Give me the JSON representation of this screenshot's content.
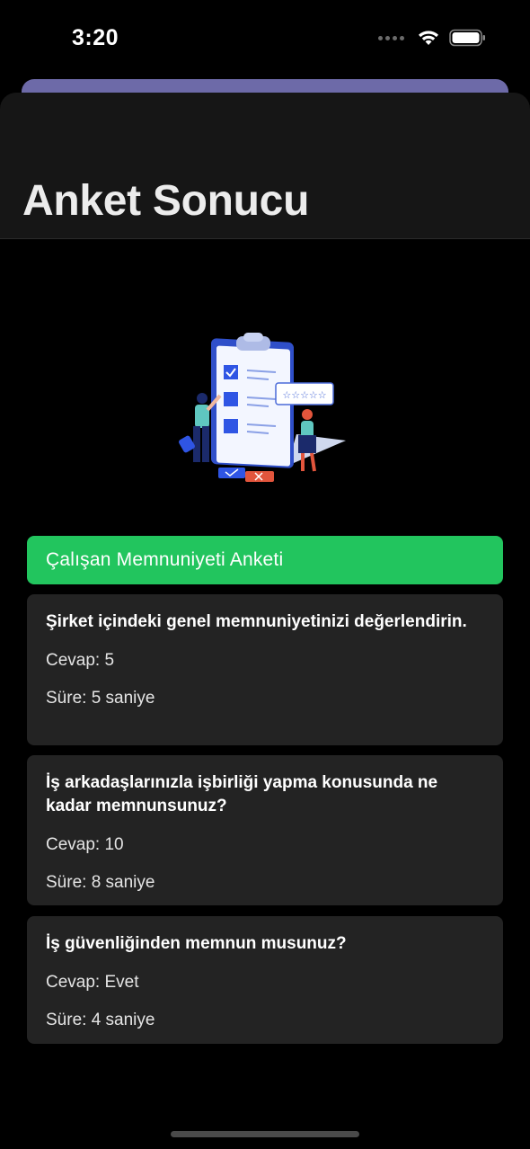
{
  "status_bar": {
    "time": "3:20"
  },
  "header": {
    "title": "Anket Sonucu"
  },
  "illustration": {
    "name": "survey-clipboard-illustration"
  },
  "survey": {
    "title": "Çalışan Memnuniyeti Anketi",
    "accent": "#22c55e"
  },
  "questions": [
    {
      "question": "Şirket içindeki genel memnuniyetinizi değerlendirin.",
      "answer": "Cevap: 5",
      "duration": "Süre: 5 saniye"
    },
    {
      "question": "İş arkadaşlarınızla işbirliği yapma konusunda ne kadar memnunsunuz?",
      "answer": "Cevap: 10",
      "duration": "Süre: 8 saniye"
    },
    {
      "question": "İş güvenliğinden memnun musunuz?",
      "answer": "Cevap: Evet",
      "duration": "Süre: 4 saniye"
    }
  ]
}
